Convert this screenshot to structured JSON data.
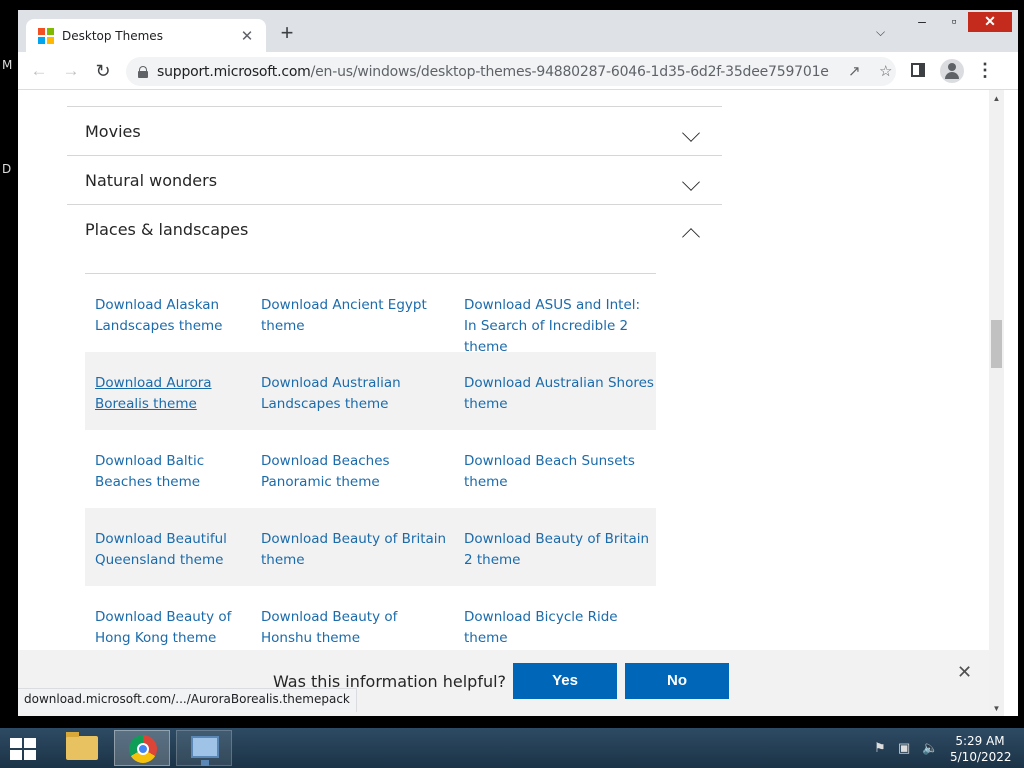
{
  "desktop": {
    "left_letters": [
      "M",
      "D"
    ]
  },
  "browser": {
    "tab_title": "Desktop Themes",
    "tab_close": "✕",
    "new_tab": "+",
    "url_host": "support.microsoft.com",
    "url_path": "/en-us/windows/desktop-themes-94880287-6046-1d35-6d2f-35dee759701e",
    "window_controls": {
      "minimize": "–",
      "maximize": "▫",
      "close": "✕"
    }
  },
  "page": {
    "accordions": [
      {
        "label": "Movies",
        "expanded": false
      },
      {
        "label": "Natural wonders",
        "expanded": false
      },
      {
        "label": "Places & landscapes",
        "expanded": true
      }
    ],
    "theme_rows": [
      {
        "shaded": false,
        "links": [
          "Download Alaskan Landscapes theme",
          "Download Ancient Egypt theme",
          "Download ASUS and Intel: In Search of Incredible 2 theme"
        ]
      },
      {
        "shaded": true,
        "links": [
          "Download Aurora Borealis theme",
          "Download Australian Landscapes theme",
          "Download Australian Shores theme"
        ]
      },
      {
        "shaded": false,
        "links": [
          "Download Baltic Beaches theme",
          "Download Beaches Panoramic theme",
          "Download Beach Sunsets theme"
        ]
      },
      {
        "shaded": true,
        "links": [
          "Download Beautiful Queensland theme",
          "Download Beauty of Britain theme",
          "Download Beauty of Britain 2 theme"
        ]
      },
      {
        "shaded": false,
        "links": [
          "Download Beauty of Hong Kong theme",
          "Download Beauty of Honshu theme",
          "Download Bicycle Ride theme"
        ]
      }
    ],
    "hovered_link": "Download Aurora Borealis theme",
    "feedback": {
      "question": "Was this information helpful?",
      "yes": "Yes",
      "no": "No",
      "close": "✕"
    },
    "status_url": "download.microsoft.com/.../AuroraBorealis.themepack"
  },
  "taskbar": {
    "time": "5:29 AM",
    "date": "5/10/2022",
    "apps": [
      "file-explorer",
      "google-chrome",
      "server-manager"
    ]
  },
  "colors": {
    "link": "#1b6bab",
    "button": "#0067b8",
    "close_red": "#c42b1c"
  }
}
